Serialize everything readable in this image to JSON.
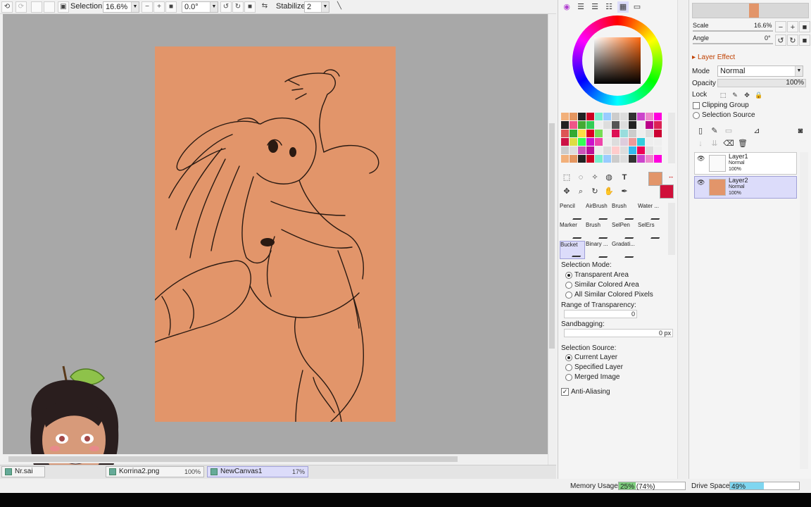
{
  "toolbar": {
    "selection_label": "Selection",
    "zoom_value": "16.6%",
    "angle_value": "0.0°",
    "stabilizer_label": "Stabilizer",
    "stabilizer_value": "2"
  },
  "tabs": [
    {
      "name": "Nr.sai",
      "zoom": ""
    },
    {
      "name": "Korrina2.png",
      "zoom": "100%"
    },
    {
      "name": "NewCanvas1",
      "zoom": "17%"
    }
  ],
  "status": {
    "memory_label": "Memory Usage",
    "memory_value": "25% (74%)",
    "memory_fraction": 0.25,
    "drive_label": "Drive Space",
    "drive_value": "49%",
    "drive_fraction": 0.49
  },
  "tools": {
    "cells": [
      "Pencil",
      "AirBrush",
      "Brush",
      "Water ...",
      "Marker",
      "Brush",
      "SelPen",
      "SelErs",
      "Bucket",
      "Binary ...",
      "Gradati..."
    ],
    "selected": "Bucket"
  },
  "bucket": {
    "selection_mode_label": "Selection Mode:",
    "mode_options": [
      "Transparent Area",
      "Similar Colored Area",
      "All Similar Colored Pixels"
    ],
    "range_label": "Range of Transparency:",
    "range_value": "0",
    "sandbagging_label": "Sandbagging:",
    "sandbagging_value": "0 px",
    "source_label": "Selection Source:",
    "source_options": [
      "Current Layer",
      "Specified Layer",
      "Merged Image"
    ],
    "antialias_label": "Anti-Aliasing"
  },
  "navigator": {
    "scale_label": "Scale",
    "scale_value": "16.6%",
    "angle_label": "Angle",
    "angle_value": "0°"
  },
  "layer_props": {
    "layer_effect_label": "Layer Effect",
    "mode_label": "Mode",
    "mode_value": "Normal",
    "opacity_label": "Opacity",
    "opacity_value": "100%",
    "lock_label": "Lock",
    "clipping_label": "Clipping Group",
    "selsource_label": "Selection Source"
  },
  "layers": [
    {
      "name": "Layer1",
      "mode": "Normal",
      "opacity": "100%"
    },
    {
      "name": "Layer2",
      "mode": "Normal",
      "opacity": "100%"
    }
  ],
  "colors": {
    "canvas_fill": "#e2956a",
    "primary": "#e2956a",
    "secondary": "#d0103a",
    "selection_highlight": "#dcdcfa"
  },
  "icons": [
    "undo-icon",
    "pointer-icon",
    "zoom-out-icon",
    "zoom-in-icon",
    "rotate-icon",
    "flip-icon",
    "pen-icon",
    "eye-icon",
    "trash-icon"
  ]
}
